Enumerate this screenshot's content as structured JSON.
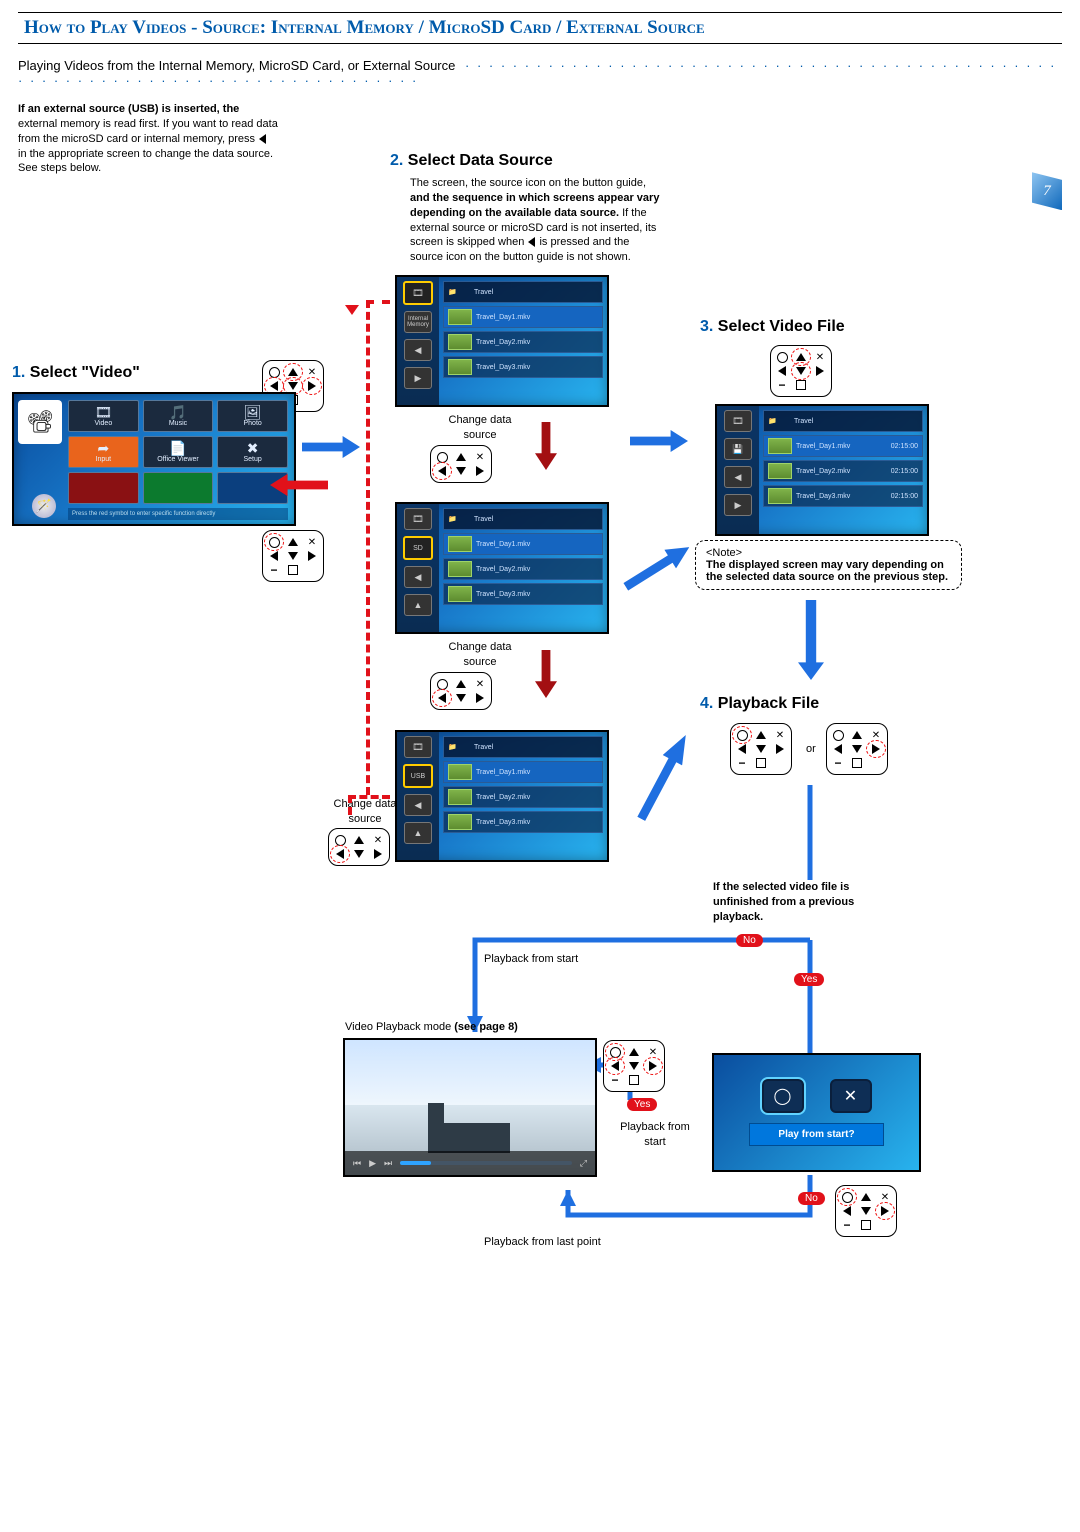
{
  "title": "How to Play Videos - Source: Internal Memory / MicroSD Card / External Source",
  "lead": "Playing Videos from the Internal Memory, MicroSD Card, or External Source",
  "intro_bold": "If an external source (USB) is inserted, the",
  "intro_rest": "external memory is read first. If you want to read data from the microSD card or internal memory, press",
  "intro_tail": "in the appropriate screen to change the data source. See steps below.",
  "steps": {
    "s1": {
      "num": "1.",
      "title": "Select \"Video\""
    },
    "s2": {
      "num": "2.",
      "title": "Select Data Source",
      "text1": "The screen, the source icon on the button guide,",
      "bold": "and the sequence in which screens appear vary depending on the available data source.",
      "text2": " If the external source or microSD card is not inserted, its screen is skipped when ",
      "text3": " is pressed and the source icon on the button guide is not shown."
    },
    "s3": {
      "num": "3.",
      "title": "Select Video File"
    },
    "s4": {
      "num": "4.",
      "title": "Playback File"
    }
  },
  "change_src": "Change data source",
  "note_head": "<Note>",
  "note_body": "The displayed screen may vary depending on the selected data source on the previous step.",
  "unfinished": "If the selected video file is unfinished from a previous playback.",
  "pb_start": "Playback from start",
  "pb_last": "Playback from last point",
  "vpm": "Video Playback mode ",
  "vpm_ref": "(see page 8)",
  "or": "or",
  "yes": "Yes",
  "no": "No",
  "dialog": "Play from start?",
  "home": {
    "cells": [
      "Video",
      "Music",
      "Photo",
      "Input",
      "Office Viewer",
      "Setup"
    ],
    "bar": "Press the red symbol to enter specific function directly"
  },
  "files": {
    "header": "Travel",
    "items": [
      "Travel_Day1.mkv",
      "Travel_Day2.mkv",
      "Travel_Day3.mkv"
    ],
    "time": "02:15:00"
  },
  "src_labels": [
    "Internal Memory",
    "SD",
    "USB"
  ],
  "pagenum": "7"
}
